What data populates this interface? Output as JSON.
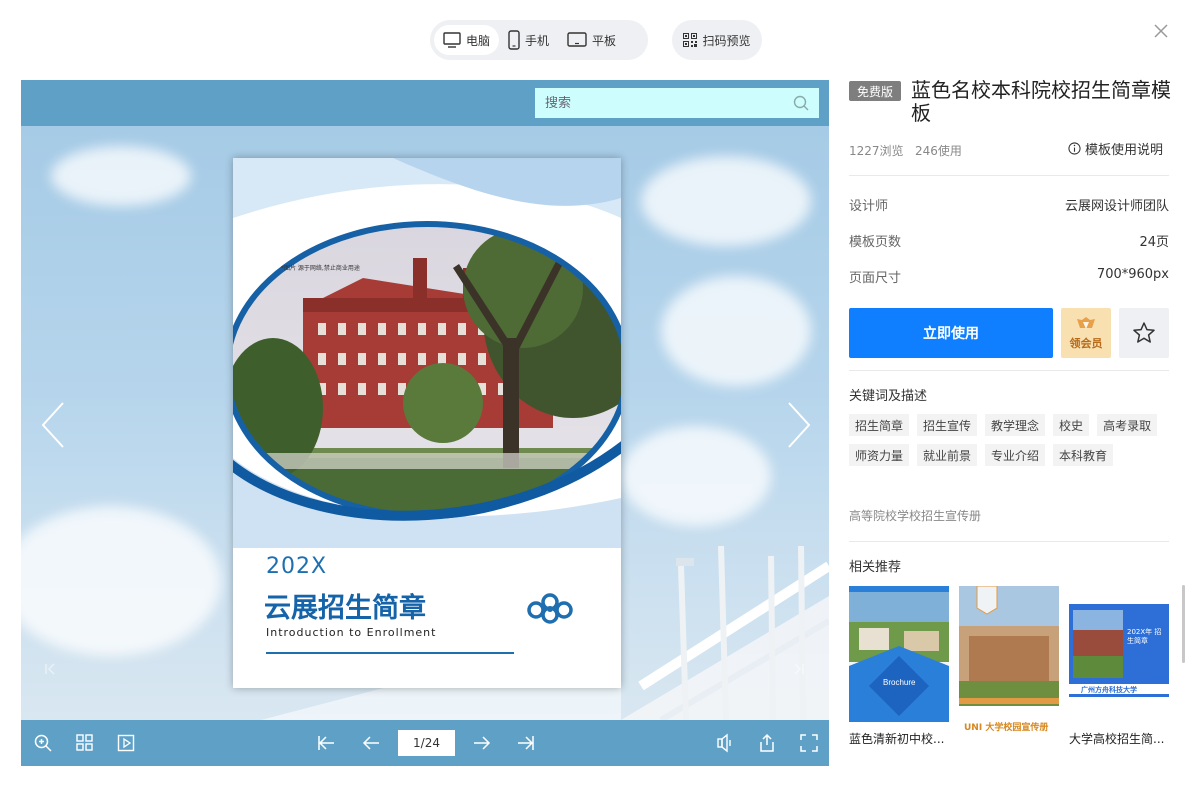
{
  "device_tabs": [
    {
      "label": "电脑",
      "icon": "monitor-icon",
      "active": true
    },
    {
      "label": "手机",
      "icon": "phone-icon",
      "active": false
    },
    {
      "label": "平板",
      "icon": "tablet-icon",
      "active": false
    }
  ],
  "qr_preview_label": "扫码预览",
  "viewer": {
    "search_placeholder": "搜索",
    "page_indicator": "1/24",
    "book": {
      "year": "202X",
      "title": "云展招生简章",
      "subtitle": "Introduction to Enrollment",
      "photo_note": "*图片 源于网络,禁止商业用途"
    }
  },
  "template": {
    "badge": "免费版",
    "title": "蓝色名校本科院校招生简章模板",
    "views": "1227浏览",
    "uses": "246使用",
    "guide_label": "模板使用说明",
    "info": [
      {
        "key": "设计师",
        "value": "云展网设计师团队"
      },
      {
        "key": "模板页数",
        "value": "24页"
      },
      {
        "key": "页面尺寸",
        "value": "700*960px"
      }
    ],
    "use_button": "立即使用",
    "vip_button": "领会员",
    "keywords_title": "关键词及描述",
    "tags": [
      "招生简章",
      "招生宣传",
      "教学理念",
      "校史",
      "高考录取",
      "师资力量",
      "就业前景",
      "专业介绍",
      "本科教育"
    ],
    "description": "高等院校学校招生宣传册",
    "related_title": "相关推荐",
    "related": [
      {
        "label": "蓝色清新初中校...",
        "thumb_text": "Brochure"
      },
      {
        "label": "",
        "thumb_text": "UNI 大学校园宣传册"
      },
      {
        "label": "大学高校招生简...",
        "thumb_text": "202X年 招生简章"
      }
    ]
  },
  "colors": {
    "viewer_bar": "#5fa1c6",
    "search_bg": "#cdfdfd",
    "primary": "#0f7fff",
    "book_blue": "#1563a8"
  }
}
